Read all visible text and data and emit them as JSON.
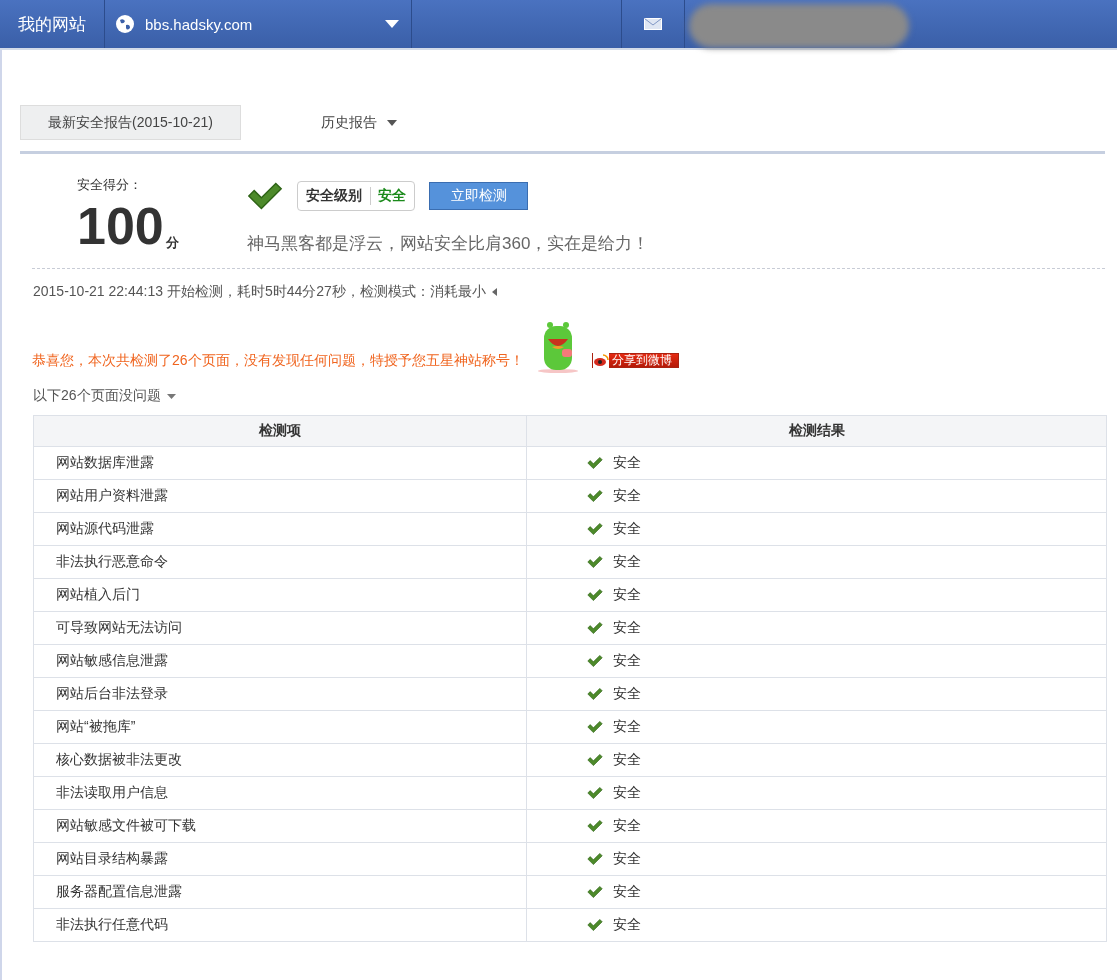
{
  "topbar": {
    "title": "我的网站",
    "site": "bbs.hadsky.com"
  },
  "tabs": [
    {
      "label": "最新安全报告(2015-10-21)",
      "selected": true
    },
    {
      "label": "历史报告",
      "selected": false
    }
  ],
  "score": {
    "label": "安全得分：",
    "value": "100",
    "unit": "分",
    "level_label": "安全级别",
    "level_value": "安全",
    "button": "立即检测",
    "slogan": "神马黑客都是浮云，网站安全比肩360，实在是给力！"
  },
  "scan_info": "2015-10-21 22:44:13 开始检测，耗时5时44分27秒，检测模式：消耗最小",
  "congrats": "恭喜您，本次共检测了26个页面，没有发现任何问题，特授予您五星神站称号！",
  "share_button": "分享到微博",
  "pages_toggle": "以下26个页面没问题",
  "table": {
    "columns": [
      "检测项",
      "检测结果"
    ],
    "rows": [
      {
        "item": "网站数据库泄露",
        "result": "安全"
      },
      {
        "item": "网站用户资料泄露",
        "result": "安全"
      },
      {
        "item": "网站源代码泄露",
        "result": "安全"
      },
      {
        "item": "非法执行恶意命令",
        "result": "安全"
      },
      {
        "item": "网站植入后门",
        "result": "安全"
      },
      {
        "item": "可导致网站无法访问",
        "result": "安全"
      },
      {
        "item": "网站敏感信息泄露",
        "result": "安全"
      },
      {
        "item": "网站后台非法登录",
        "result": "安全"
      },
      {
        "item": "网站“被拖库”",
        "result": "安全"
      },
      {
        "item": "核心数据被非法更改",
        "result": "安全"
      },
      {
        "item": "非法读取用户信息",
        "result": "安全"
      },
      {
        "item": "网站敏感文件被可下载",
        "result": "安全"
      },
      {
        "item": "网站目录结构暴露",
        "result": "安全"
      },
      {
        "item": "服务器配置信息泄露",
        "result": "安全"
      },
      {
        "item": "非法执行任意代码",
        "result": "安全"
      }
    ]
  }
}
